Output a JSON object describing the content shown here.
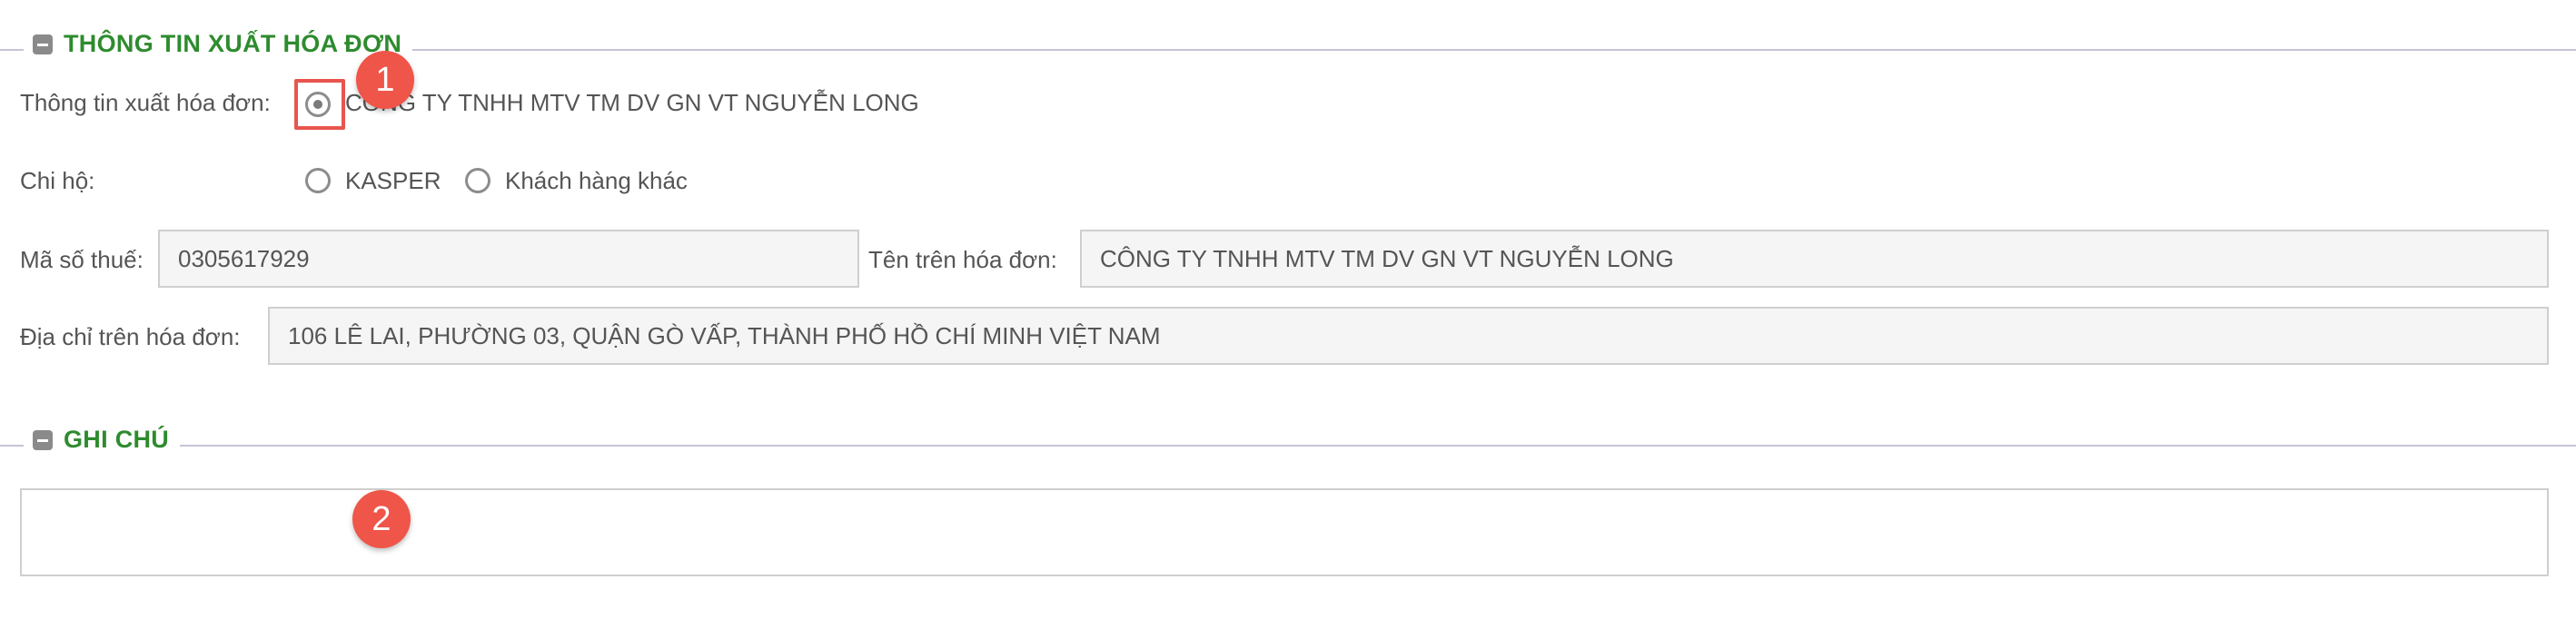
{
  "invoice_section": {
    "title": "THÔNG TIN XUẤT HÓA ĐƠN",
    "invoice_info_label": "Thông tin xuất hóa đơn:",
    "invoice_option_label": "CÔNG TY TNHH MTV TM DV GN VT NGUYỄN LONG",
    "pay_on_behalf_label": "Chi hộ:",
    "pay_on_behalf_options": [
      "KASPER",
      "Khách hàng khác"
    ],
    "tax_code_label": "Mã số thuế:",
    "tax_code_value": "0305617929",
    "invoice_name_label": "Tên trên hóa đơn:",
    "invoice_name_value": "CÔNG TY TNHH MTV TM DV GN VT NGUYỄN LONG",
    "address_label": "Địa chỉ trên hóa đơn:",
    "address_value": "106 LÊ LAI, PHƯỜNG 03, QUẬN GÒ VẤP, THÀNH PHỐ HỒ CHÍ MINH VIỆT NAM"
  },
  "notes_section": {
    "title": "GHI CHÚ",
    "notes_value": ""
  },
  "annotations": {
    "badge_1": "1",
    "badge_2": "2"
  },
  "colors": {
    "section_title": "#2e8b2e",
    "annotation": "#ef5548",
    "field_background": "#f5f5f5"
  }
}
